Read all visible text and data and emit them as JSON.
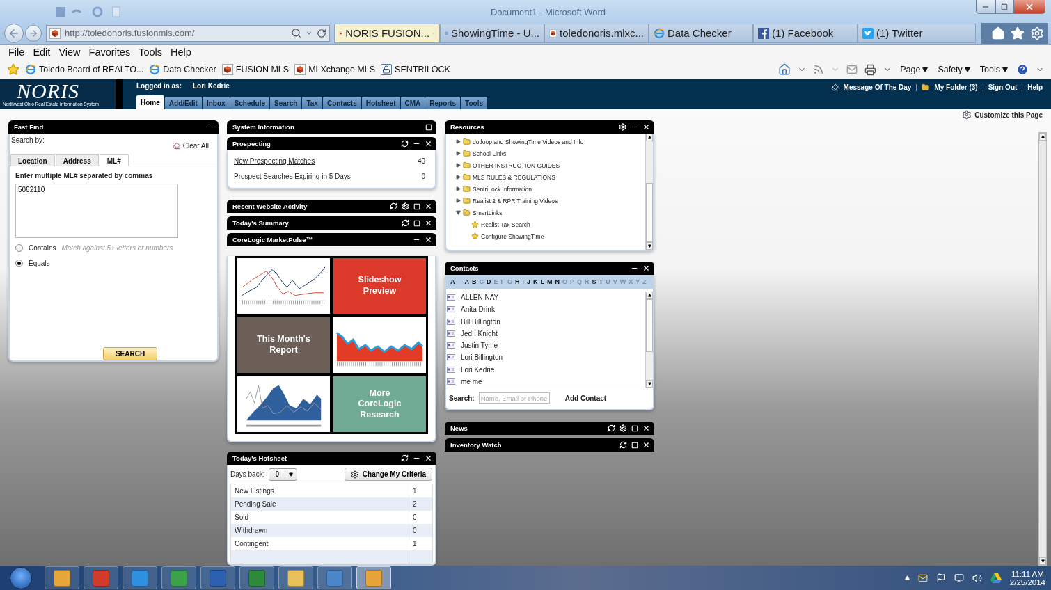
{
  "word_window": {
    "title": "Document1 - Microsoft Word"
  },
  "browser": {
    "address": "http://toledonoris.fusionmls.com/",
    "tabs": [
      {
        "label": "NORIS FUSION...",
        "selected": true,
        "kind": "fusion"
      },
      {
        "label": "ShowingTime - U...",
        "selected": false,
        "kind": "ie"
      },
      {
        "label": "toledonoris.mlxc...",
        "selected": false,
        "kind": "fusion"
      },
      {
        "label": "Data Checker",
        "selected": false,
        "kind": "ie"
      },
      {
        "label": "(1) Facebook",
        "selected": false,
        "kind": "facebook"
      },
      {
        "label": "(1) Twitter",
        "selected": false,
        "kind": "twitter"
      }
    ],
    "menu": [
      "File",
      "Edit",
      "View",
      "Favorites",
      "Tools",
      "Help"
    ],
    "favorites": [
      {
        "label": "Toledo Board of REALTO...",
        "kind": "ie"
      },
      {
        "label": "Data Checker",
        "kind": "ie"
      },
      {
        "label": "FUSION MLS",
        "kind": "fusion"
      },
      {
        "label": "MLXchange MLS",
        "kind": "fusion"
      },
      {
        "label": "SENTRILOCK",
        "kind": "lock"
      }
    ],
    "command_bar": [
      "Page",
      "Safety",
      "Tools"
    ]
  },
  "noris": {
    "logo": "NORIS",
    "tagline": "Northwest Ohio Real Estate Information System",
    "logged_in_label": "Logged in as:",
    "user": "Lori Kedrie",
    "nav": [
      {
        "label": "Home",
        "selected": true
      },
      {
        "label": "Add/Edit",
        "selected": false
      },
      {
        "label": "Inbox",
        "selected": false
      },
      {
        "label": "Schedule",
        "selected": false
      },
      {
        "label": "Search",
        "selected": false
      },
      {
        "label": "Tax",
        "selected": false
      },
      {
        "label": "Contacts",
        "selected": false
      },
      {
        "label": "Hotsheet",
        "selected": false
      },
      {
        "label": "CMA",
        "selected": false
      },
      {
        "label": "Reports",
        "selected": false
      },
      {
        "label": "Tools",
        "selected": false
      }
    ],
    "links": [
      "Message Of The Day",
      "My Folder (3)",
      "Sign Out",
      "Help"
    ],
    "customize": "Customize this Page"
  },
  "fast_find": {
    "title": "Fast Find",
    "search_by": "Search by:",
    "clear_all": "Clear All",
    "tabs": [
      {
        "label": "Location",
        "selected": false
      },
      {
        "label": "Address",
        "selected": false
      },
      {
        "label": "ML#",
        "selected": true
      }
    ],
    "instruction": "Enter multiple ML# separated by commas",
    "value": "5062110",
    "options": [
      {
        "label": "Contains",
        "hint": "Match against 5+ letters or numbers",
        "selected": false
      },
      {
        "label": "Equals",
        "selected": true
      }
    ],
    "search_button": "SEARCH"
  },
  "system_information": {
    "title": "System Information"
  },
  "prospecting": {
    "title": "Prospecting",
    "rows": [
      {
        "label": "New Prospecting Matches",
        "count": "40"
      },
      {
        "label": "Prospect Searches Expiring in 5 Days",
        "count": "0"
      }
    ]
  },
  "recent_website_activity": {
    "title": "Recent Website Activity"
  },
  "todays_summary": {
    "title": "Today's Summary"
  },
  "marketpulse": {
    "title": "CoreLogic MarketPulse™",
    "tiles": [
      {
        "kind": "line_chart"
      },
      {
        "kind": "text",
        "label": "Slideshow Preview",
        "color": "#db3a2b"
      },
      {
        "kind": "text",
        "label": "This Month's Report",
        "color": "#6b5f57"
      },
      {
        "kind": "red_area_chart"
      },
      {
        "kind": "blue_area_chart"
      },
      {
        "kind": "text",
        "label": "More CoreLogic Research",
        "color": "#72ab95"
      }
    ]
  },
  "hotsheet": {
    "title": "Today's Hotsheet",
    "days_back_label": "Days back:",
    "days_back": "0",
    "criteria_button": "Change My Criteria",
    "rows": [
      {
        "label": "New Listings",
        "count": "1"
      },
      {
        "label": "Pending Sale",
        "count": "2"
      },
      {
        "label": "Sold",
        "count": "0"
      },
      {
        "label": "Withdrawn",
        "count": "0"
      },
      {
        "label": "Contingent",
        "count": "1"
      }
    ]
  },
  "resources": {
    "title": "Resources",
    "tree": [
      {
        "label": "dotloop and ShowingTime Videos and Info",
        "expanded": false
      },
      {
        "label": "School Links",
        "expanded": false
      },
      {
        "label": "OTHER INSTRUCTION GUIDES",
        "expanded": false
      },
      {
        "label": "MLS RULES & REGULATIONS",
        "expanded": false
      },
      {
        "label": "SentriLock Information",
        "expanded": false
      },
      {
        "label": "Realist 2 & RPR Training Videos",
        "expanded": false
      },
      {
        "label": "SmartLinks",
        "expanded": true,
        "children": [
          {
            "label": "Realist Tax Search"
          },
          {
            "label": "Configure ShowingTime"
          }
        ]
      }
    ]
  },
  "contacts": {
    "title": "Contacts",
    "letters": [
      {
        "label": "A",
        "selected": true,
        "disabled": false
      },
      {
        "label": "A",
        "selected": false,
        "disabled": false
      },
      {
        "label": "B",
        "selected": false,
        "disabled": false
      },
      {
        "label": "C",
        "selected": false,
        "disabled": true
      },
      {
        "label": "D",
        "selected": false,
        "disabled": false
      },
      {
        "label": "E",
        "selected": false,
        "disabled": true
      },
      {
        "label": "F",
        "selected": false,
        "disabled": true
      },
      {
        "label": "G",
        "selected": false,
        "disabled": true
      },
      {
        "label": "H",
        "selected": false,
        "disabled": false
      },
      {
        "label": "I",
        "selected": false,
        "disabled": true
      },
      {
        "label": "J",
        "selected": false,
        "disabled": false
      },
      {
        "label": "K",
        "selected": false,
        "disabled": false
      },
      {
        "label": "L",
        "selected": false,
        "disabled": false
      },
      {
        "label": "M",
        "selected": false,
        "disabled": false
      },
      {
        "label": "N",
        "selected": false,
        "disabled": false
      },
      {
        "label": "O",
        "selected": false,
        "disabled": true
      },
      {
        "label": "P",
        "selected": false,
        "disabled": true
      },
      {
        "label": "Q",
        "selected": false,
        "disabled": true
      },
      {
        "label": "R",
        "selected": false,
        "disabled": true
      },
      {
        "label": "S",
        "selected": false,
        "disabled": false
      },
      {
        "label": "T",
        "selected": false,
        "disabled": false
      },
      {
        "label": "U",
        "selected": false,
        "disabled": true
      },
      {
        "label": "V",
        "selected": false,
        "disabled": true
      },
      {
        "label": "W",
        "selected": false,
        "disabled": true
      },
      {
        "label": "X",
        "selected": false,
        "disabled": true
      },
      {
        "label": "Y",
        "selected": false,
        "disabled": true
      },
      {
        "label": "Z",
        "selected": false,
        "disabled": true
      }
    ],
    "list": [
      "ALLEN NAY",
      "Anita Drink",
      "Bill Billington",
      "Jed I Knight",
      "Justin Tyme",
      "Lori Billington",
      "Lori Kedrie",
      "me me"
    ],
    "search_label": "Search:",
    "search_placeholder": "Name, Email or Phone",
    "add_contact": "Add Contact"
  },
  "news": {
    "title": "News"
  },
  "inventory_watch": {
    "title": "Inventory Watch"
  },
  "taskbar": {
    "time": "11:11 AM",
    "date": "2/25/2014"
  }
}
